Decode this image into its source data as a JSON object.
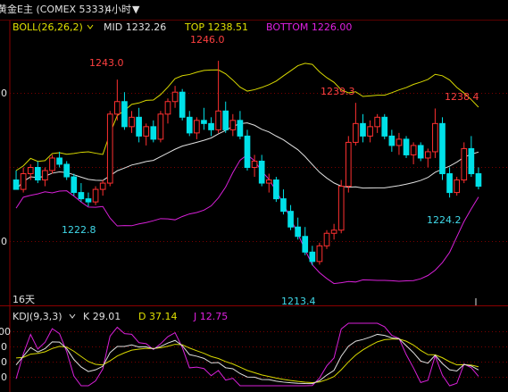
{
  "header": {
    "instrument": "黄金E主 (COMEX 5333)",
    "period": "4小时",
    "period_caret": "▼"
  },
  "boll": {
    "label": "BOLL(26,26,2)",
    "mid": "MID 1232.26",
    "top": "TOP 1238.51",
    "bottom": "BOTTOM 1226.00",
    "colors": {
      "label": "#e0e000",
      "mid": "#e0e0e0",
      "top": "#e0e000",
      "bottom": "#e020e0"
    }
  },
  "kdj": {
    "label": "KDJ(9,3,3)",
    "k": "K 29.01",
    "d": "D 37.14",
    "j": "J 12.75",
    "colors": {
      "k": "#e0e0e0",
      "d": "#e0e000",
      "j": "#e020e0"
    }
  },
  "price_axis": {
    "upper": "0",
    "lower": "0"
  },
  "kdj_axis": {
    "labels": [
      "00",
      "0",
      "0",
      "0"
    ]
  },
  "price_labels": [
    {
      "text": "1243.0",
      "color": "#ff4040"
    },
    {
      "text": "1246.0",
      "color": "#ff4040"
    },
    {
      "text": "1239.3",
      "color": "#ff4040"
    },
    {
      "text": "1238.4",
      "color": "#ff4040"
    },
    {
      "text": "1222.8",
      "color": "#40d8e8"
    },
    {
      "text": "1213.4",
      "color": "#40d8e8"
    },
    {
      "text": "1224.2",
      "color": "#40d8e8"
    }
  ],
  "period_count": "16天",
  "chart_data": {
    "type": "candlestick",
    "title": "黄金E主 (COMEX 5333) 4小时",
    "y_range": [
      1208,
      1250
    ],
    "highs_lows": {
      "high": 1246.0,
      "low": 1213.4
    },
    "colors": {
      "up": "#ff3030",
      "down": "#00e0e8",
      "grid": "#7a0000"
    },
    "candles": [
      [
        1227.0,
        1228.5,
        1225.5,
        1225.5
      ],
      [
        1225.5,
        1229.0,
        1225.0,
        1228.0
      ],
      [
        1228.0,
        1229.5,
        1227.0,
        1229.0
      ],
      [
        1229.0,
        1230.0,
        1226.5,
        1227.0
      ],
      [
        1227.0,
        1229.0,
        1226.0,
        1228.5
      ],
      [
        1228.5,
        1231.0,
        1228.0,
        1230.5
      ],
      [
        1230.5,
        1231.5,
        1229.0,
        1229.5
      ],
      [
        1229.5,
        1230.0,
        1227.0,
        1227.5
      ],
      [
        1227.5,
        1228.0,
        1224.5,
        1225.0
      ],
      [
        1225.0,
        1226.5,
        1223.5,
        1224.0
      ],
      [
        1224.0,
        1225.0,
        1222.8,
        1223.5
      ],
      [
        1223.5,
        1226.0,
        1223.0,
        1225.5
      ],
      [
        1225.5,
        1227.0,
        1224.5,
        1226.5
      ],
      [
        1226.5,
        1238.0,
        1226.0,
        1237.5
      ],
      [
        1237.5,
        1243.0,
        1236.5,
        1239.5
      ],
      [
        1239.5,
        1241.0,
        1235.0,
        1235.5
      ],
      [
        1235.5,
        1238.0,
        1234.5,
        1237.0
      ],
      [
        1237.0,
        1238.5,
        1233.0,
        1234.0
      ],
      [
        1234.0,
        1236.0,
        1232.5,
        1235.5
      ],
      [
        1235.5,
        1236.5,
        1233.0,
        1233.5
      ],
      [
        1233.5,
        1238.0,
        1233.0,
        1237.5
      ],
      [
        1237.5,
        1240.0,
        1236.0,
        1239.5
      ],
      [
        1239.5,
        1242.0,
        1238.5,
        1241.0
      ],
      [
        1241.0,
        1241.5,
        1236.5,
        1237.0
      ],
      [
        1237.0,
        1238.0,
        1234.0,
        1234.5
      ],
      [
        1234.5,
        1237.0,
        1233.5,
        1236.5
      ],
      [
        1236.5,
        1238.5,
        1235.0,
        1236.0
      ],
      [
        1236.0,
        1237.0,
        1234.0,
        1235.0
      ],
      [
        1235.0,
        1246.0,
        1234.5,
        1238.0
      ],
      [
        1238.0,
        1239.5,
        1234.5,
        1235.0
      ],
      [
        1235.0,
        1237.5,
        1234.0,
        1236.5
      ],
      [
        1236.5,
        1238.0,
        1233.5,
        1234.0
      ],
      [
        1234.0,
        1235.0,
        1228.5,
        1229.0
      ],
      [
        1229.0,
        1231.0,
        1227.5,
        1230.0
      ],
      [
        1230.0,
        1231.0,
        1226.0,
        1226.5
      ],
      [
        1226.5,
        1228.0,
        1225.0,
        1227.0
      ],
      [
        1227.0,
        1227.5,
        1223.5,
        1224.0
      ],
      [
        1224.0,
        1225.5,
        1221.5,
        1222.0
      ],
      [
        1222.0,
        1223.0,
        1219.0,
        1219.5
      ],
      [
        1219.5,
        1221.0,
        1217.5,
        1218.0
      ],
      [
        1218.0,
        1219.5,
        1215.0,
        1215.5
      ],
      [
        1215.5,
        1216.5,
        1213.4,
        1214.0
      ],
      [
        1214.0,
        1217.0,
        1213.5,
        1216.5
      ],
      [
        1216.5,
        1219.0,
        1216.0,
        1218.5
      ],
      [
        1218.5,
        1220.0,
        1217.5,
        1219.0
      ],
      [
        1219.0,
        1227.0,
        1218.5,
        1226.0
      ],
      [
        1226.0,
        1234.0,
        1225.0,
        1233.0
      ],
      [
        1233.0,
        1239.3,
        1232.5,
        1236.0
      ],
      [
        1236.0,
        1237.5,
        1233.0,
        1234.0
      ],
      [
        1234.0,
        1236.5,
        1233.0,
        1235.5
      ],
      [
        1235.5,
        1237.5,
        1234.5,
        1237.0
      ],
      [
        1237.0,
        1237.5,
        1233.5,
        1234.0
      ],
      [
        1234.0,
        1235.0,
        1231.5,
        1232.5
      ],
      [
        1232.5,
        1234.5,
        1231.0,
        1233.5
      ],
      [
        1233.5,
        1234.0,
        1230.5,
        1231.0
      ],
      [
        1231.0,
        1233.0,
        1229.5,
        1232.5
      ],
      [
        1232.5,
        1233.0,
        1230.0,
        1230.5
      ],
      [
        1230.5,
        1232.0,
        1229.0,
        1231.5
      ],
      [
        1231.5,
        1238.4,
        1230.5,
        1236.0
      ],
      [
        1236.0,
        1237.0,
        1227.0,
        1228.0
      ],
      [
        1228.0,
        1229.0,
        1224.2,
        1225.0
      ],
      [
        1225.0,
        1227.5,
        1224.5,
        1227.0
      ],
      [
        1227.0,
        1233.0,
        1226.5,
        1232.0
      ],
      [
        1232.0,
        1234.0,
        1227.5,
        1228.0
      ],
      [
        1228.0,
        1229.0,
        1225.5,
        1226.0
      ]
    ]
  }
}
